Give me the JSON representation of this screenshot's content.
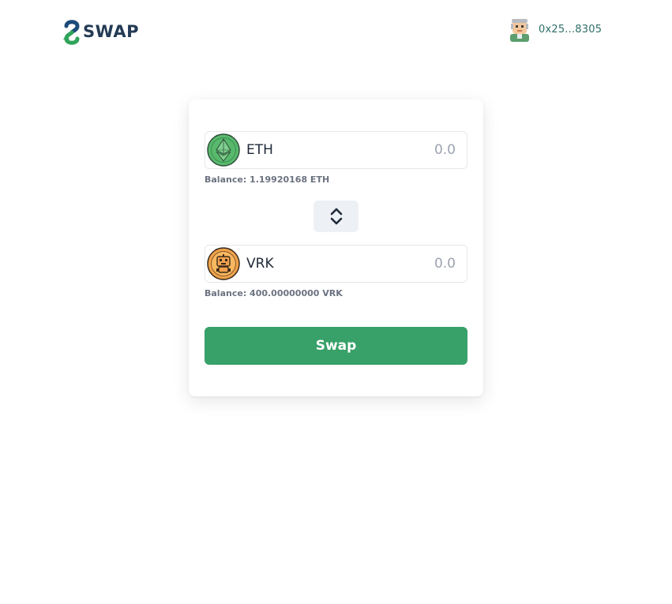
{
  "header": {
    "logo_text": "SWAP",
    "account": {
      "address": "0x25...8305",
      "avatar_icon": "user-avatar-icon"
    }
  },
  "swap_card": {
    "from": {
      "symbol": "ETH",
      "icon": "ethereum-icon",
      "amount_placeholder": "0.0",
      "amount_value": "",
      "balance": "Balance: 1.19920168 ETH"
    },
    "flip_icon": "chevron-up-down-icon",
    "to": {
      "symbol": "VRK",
      "icon": "vrk-robot-icon",
      "amount_placeholder": "0.0",
      "amount_value": "",
      "balance": "Balance: 400.00000000 VRK"
    },
    "swap_label": "Swap"
  },
  "colors": {
    "accent_green": "#38a169",
    "logo_green": "#2fa35a",
    "logo_blue": "#1c4b7a",
    "eth_green": "#58b96c",
    "vrk_orange": "#f0a24a",
    "address_text": "#2f6f6a"
  }
}
